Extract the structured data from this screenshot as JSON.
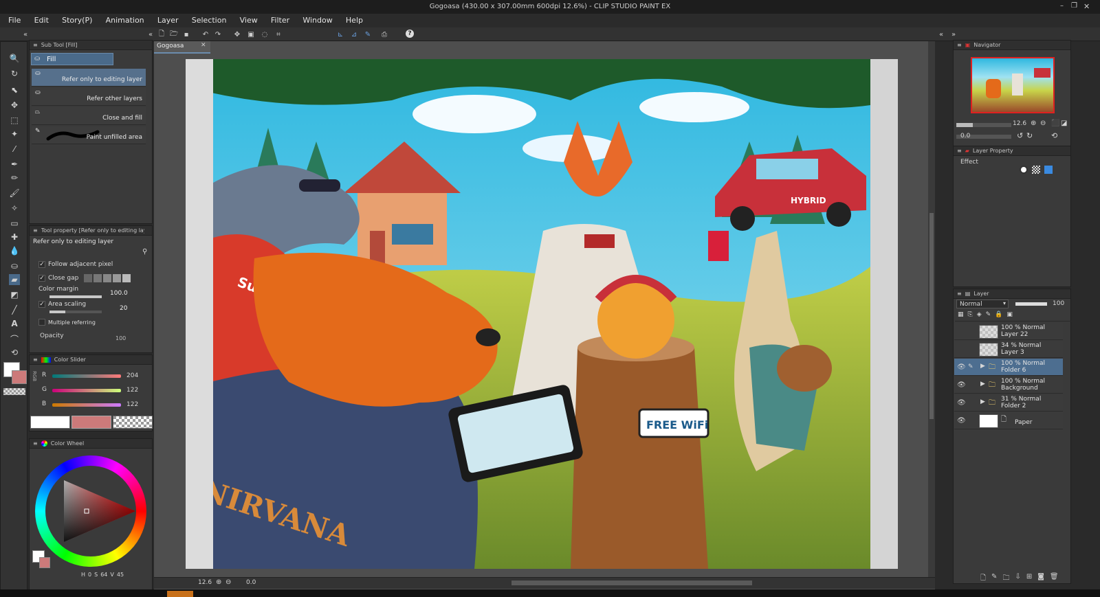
{
  "window": {
    "title": "Gogoasa (430.00 x 307.00mm 600dpi 12.6%) - CLIP STUDIO PAINT EX"
  },
  "menu": [
    "File",
    "Edit",
    "Story(P)",
    "Animation",
    "Layer",
    "Selection",
    "View",
    "Filter",
    "Window",
    "Help"
  ],
  "document_tab": "Gogoasa",
  "sub_tool": {
    "title": "Sub Tool [Fill]",
    "group": "Fill",
    "items": [
      "Refer only to editing layer",
      "Refer other layers",
      "Close and fill",
      "Paint unfilled area"
    ]
  },
  "tool_property": {
    "title": "Tool property [Refer only to editing layer]",
    "name": "Refer only to editing layer",
    "follow_adjacent": "Follow adjacent pixel",
    "close_gap": "Close gap",
    "color_margin_label": "Color margin",
    "color_margin_value": "100.0",
    "area_scaling_label": "Area scaling",
    "area_scaling_value": "20",
    "multiple_referring": "Multiple referring",
    "opacity_label": "Opacity",
    "opacity_value": "100"
  },
  "color_slider": {
    "title": "Color Slider",
    "mode": "RGB",
    "r_label": "R",
    "r_value": "204",
    "g_label": "G",
    "g_value": "122",
    "b_label": "B",
    "b_value": "122",
    "color": "#cc7a7a"
  },
  "color_wheel": {
    "title": "Color Wheel",
    "h_label": "H",
    "h_value": "0",
    "s_label": "S",
    "s_value": "64",
    "v_label": "V",
    "v_value": "45"
  },
  "navigator": {
    "title": "Navigator",
    "zoom": "12.6",
    "rotation": "0.0"
  },
  "layer_property": {
    "title": "Layer Property",
    "effect_label": "Effect"
  },
  "layer_panel": {
    "title": "Layer",
    "blend_mode": "Normal",
    "opacity": "100",
    "layers": [
      {
        "opacity": "100 %",
        "mode": "Normal",
        "name": "Layer 22"
      },
      {
        "opacity": "34 %",
        "mode": "Normal",
        "name": "Layer 3"
      },
      {
        "opacity": "100 %",
        "mode": "Normal",
        "name": "Folder 6"
      },
      {
        "opacity": "100 %",
        "mode": "Normal",
        "name": "Background"
      },
      {
        "opacity": "31 %",
        "mode": "Normal",
        "name": "Folder 2"
      },
      {
        "opacity": "",
        "mode": "",
        "name": "Paper"
      }
    ]
  },
  "canvas": {
    "sign_text": "FREE WiFi",
    "shirt_text": "NIRVANA",
    "sticker_text": "Sup",
    "car_text": "HYBRID"
  },
  "status": {
    "zoom": "12.6",
    "rotation": "0.0"
  },
  "colors": {
    "accent": "#4a6a8a",
    "canvas_bg": "#4e4e4e",
    "main_color": "#ffffff",
    "sub_color": "#cc7a7a"
  }
}
